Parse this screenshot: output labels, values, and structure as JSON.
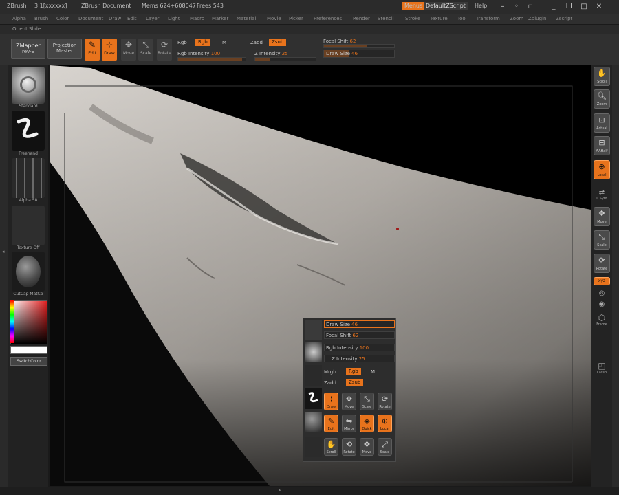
{
  "titlebar": {
    "app": "ZBrush",
    "version": "3.1[xxxxxx]",
    "document": "ZBrush Document",
    "mem": "Mems 624+608047",
    "frees": "Frees 543",
    "menus_button": "Menus",
    "script": "DefaultZScript",
    "help": "Help"
  },
  "menubar": {
    "items": [
      "Alpha",
      "Brush",
      "Color",
      "Document",
      "Draw",
      "Edit",
      "Layer",
      "Light",
      "Macro",
      "Marker",
      "Material",
      "Movie",
      "Picker",
      "Preferences",
      "Render",
      "Stencil",
      "Stroke",
      "Texture",
      "Tool",
      "Transform",
      "Zoom",
      "Zplugin",
      "Zscript"
    ]
  },
  "subbar": {
    "label": "Orient Slide"
  },
  "shelf": {
    "zmapper": "ZMapper",
    "zmapper_sub": "rev-E",
    "projection": "Projection",
    "projection_sub": "Master",
    "edit": "Edit",
    "draw": "Draw",
    "move": "Move",
    "scale": "Scale",
    "rotate": "Rotate",
    "rgb_label": "Rgb",
    "rgb_value": "Rgb",
    "m_label": "M",
    "rgb_intensity_label": "Rgb Intensity",
    "rgb_intensity_value": "100",
    "rgb_intensity_pct": 0.95,
    "zadd_label": "Zadd",
    "zsub_value": "Zsub",
    "z_intensity_label": "Z Intensity",
    "z_intensity_value": "25",
    "z_intensity_pct": 0.25,
    "focal_label": "Focal Shift",
    "focal_value": "62",
    "focal_pct": 0.62,
    "draw_size_label": "Draw Size",
    "draw_size_value": "46",
    "draw_size_pct": 0.35
  },
  "left": {
    "brush": "Standard",
    "stroke": "Freehand",
    "alpha": "Alpha 58",
    "texture": "Texture Off",
    "material": "CutCap MatCb",
    "switch": "SwitchColor"
  },
  "right": {
    "scroll": "Scroll",
    "zoom": "Zoom",
    "actual": "Actual",
    "aahalf": "AAHalf",
    "local": "Local",
    "lsym": "L.Sym",
    "move": "Move",
    "scale": "Scale",
    "rotate": "Rotate",
    "xyz": "xyz",
    "frame": "Frame",
    "lasso": "Lasso"
  },
  "popup": {
    "draw_size": "Draw Size",
    "draw_size_value": "46",
    "focal_shift": "Focal Shift",
    "focal_value": "62",
    "rgb_intensity": "Rgb Intensity",
    "rgb_intensity_value": "100",
    "z_intensity": "Z Intensity",
    "z_intensity_value": "25",
    "mrgb": "Mrgb",
    "rgb": "Rgb",
    "m": "M",
    "zadd": "Zadd",
    "zsub": "Zsub",
    "thumbs": [
      "Standard",
      "Freehand",
      "Alpha 5",
      "Material",
      "Texture"
    ],
    "buttons": [
      "Draw",
      "Move",
      "Scale",
      "Rotate",
      "Edit",
      "Mirror",
      "Quick",
      "Local",
      "Scroll",
      "Rotate",
      "Move",
      "Scale"
    ]
  },
  "colors": {
    "accent": "#e8731c",
    "panel": "#303030",
    "canvas_bg": "#000000"
  }
}
